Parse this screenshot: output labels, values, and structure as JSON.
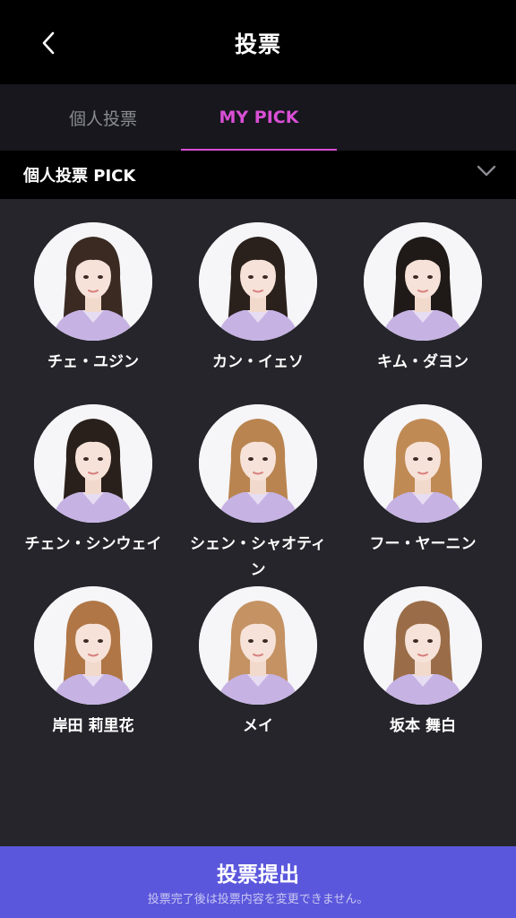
{
  "header": {
    "title": "投票",
    "back_icon": "chevron-left-icon"
  },
  "tabs": [
    {
      "label": "個人投票",
      "active": false
    },
    {
      "label": "MY PICK",
      "active": true
    }
  ],
  "section": {
    "label": "個人投票 PICK",
    "icon": "chevron-down-icon"
  },
  "members": [
    {
      "name": "チェ・ユジン",
      "hair": "#3a2a22"
    },
    {
      "name": "カン・イェソ",
      "hair": "#2b211c"
    },
    {
      "name": "キム・ダヨン",
      "hair": "#1f1a18"
    },
    {
      "name": "チェン・シンウェイ",
      "hair": "#2a201b"
    },
    {
      "name": "シェン・シャオティン",
      "hair": "#b9844f"
    },
    {
      "name": "フー・ヤーニン",
      "hair": "#c08a55"
    },
    {
      "name": "岸田 莉里花",
      "hair": "#b07646"
    },
    {
      "name": "メイ",
      "hair": "#c49263"
    },
    {
      "name": "坂本 舞白",
      "hair": "#9a6d48"
    }
  ],
  "colors": {
    "accent": "#d94fd5",
    "submit_bg": "#5b57dc",
    "shirt": "#c6b2e3"
  },
  "submit": {
    "label": "投票提出",
    "note": "投票完了後は投票内容を変更できません。"
  }
}
